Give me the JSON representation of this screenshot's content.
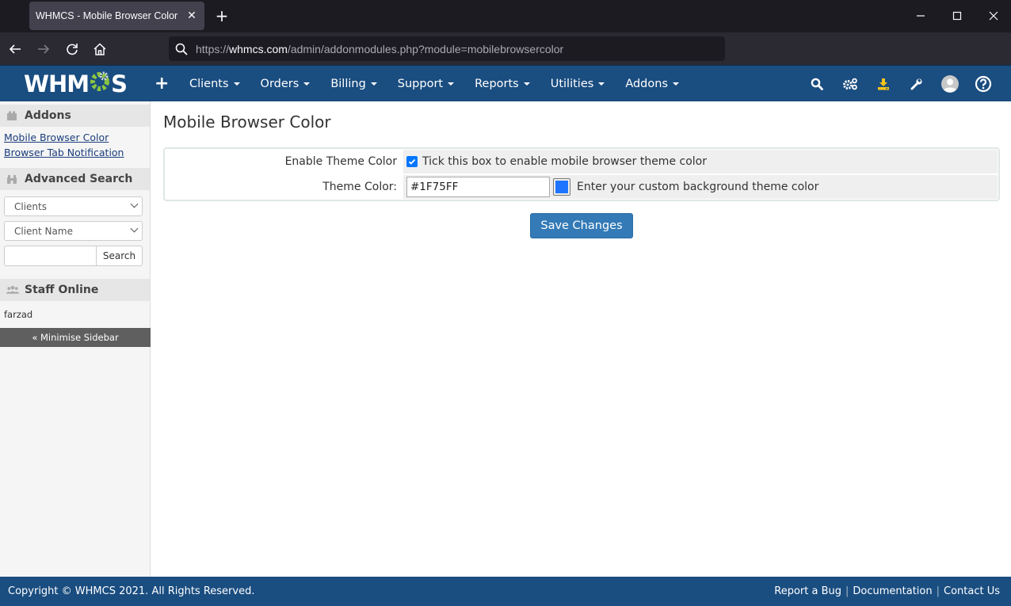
{
  "browser": {
    "tab_title": "WHMCS - Mobile Browser Color",
    "url_prefix": "https://",
    "url_host": "whmcs.com",
    "url_path": "/admin/addonmodules.php?module=mobilebrowsercolor"
  },
  "topnav": {
    "logo_left": "WHM",
    "logo_right": "S",
    "menu": [
      {
        "label": "Clients"
      },
      {
        "label": "Orders"
      },
      {
        "label": "Billing"
      },
      {
        "label": "Support"
      },
      {
        "label": "Reports"
      },
      {
        "label": "Utilities"
      },
      {
        "label": "Addons"
      }
    ],
    "icons": [
      "search-icon",
      "settings-icon",
      "update-download-icon",
      "wrench-icon",
      "user-avatar-icon",
      "help-icon"
    ],
    "accent_colors": {
      "bar": "#1a4d80",
      "download": "#f5c518",
      "logo_gear": "#8cc63f"
    }
  },
  "sidebar": {
    "addons_title": "Addons",
    "addon_links": [
      "Mobile Browser Color",
      "Browser Tab Notification"
    ],
    "advanced_search_title": "Advanced Search",
    "search_type": "Clients",
    "search_field": "Client Name",
    "search_value": "",
    "search_button": "Search",
    "staff_title": "Staff Online",
    "staff": [
      "farzad"
    ],
    "minimise": "« Minimise Sidebar"
  },
  "main": {
    "title": "Mobile Browser Color",
    "fields": {
      "enable_label": "Enable Theme Color",
      "enable_checked": true,
      "enable_description": "Tick this box to enable mobile browser theme color",
      "color_label": "Theme Color:",
      "color_value": "#1F75FF",
      "color_description": "Enter your custom background theme color"
    },
    "save_button": "Save Changes"
  },
  "footer": {
    "copyright": "Copyright © WHMCS 2021. All Rights Reserved.",
    "links": [
      "Report a Bug",
      "Documentation",
      "Contact Us"
    ]
  }
}
